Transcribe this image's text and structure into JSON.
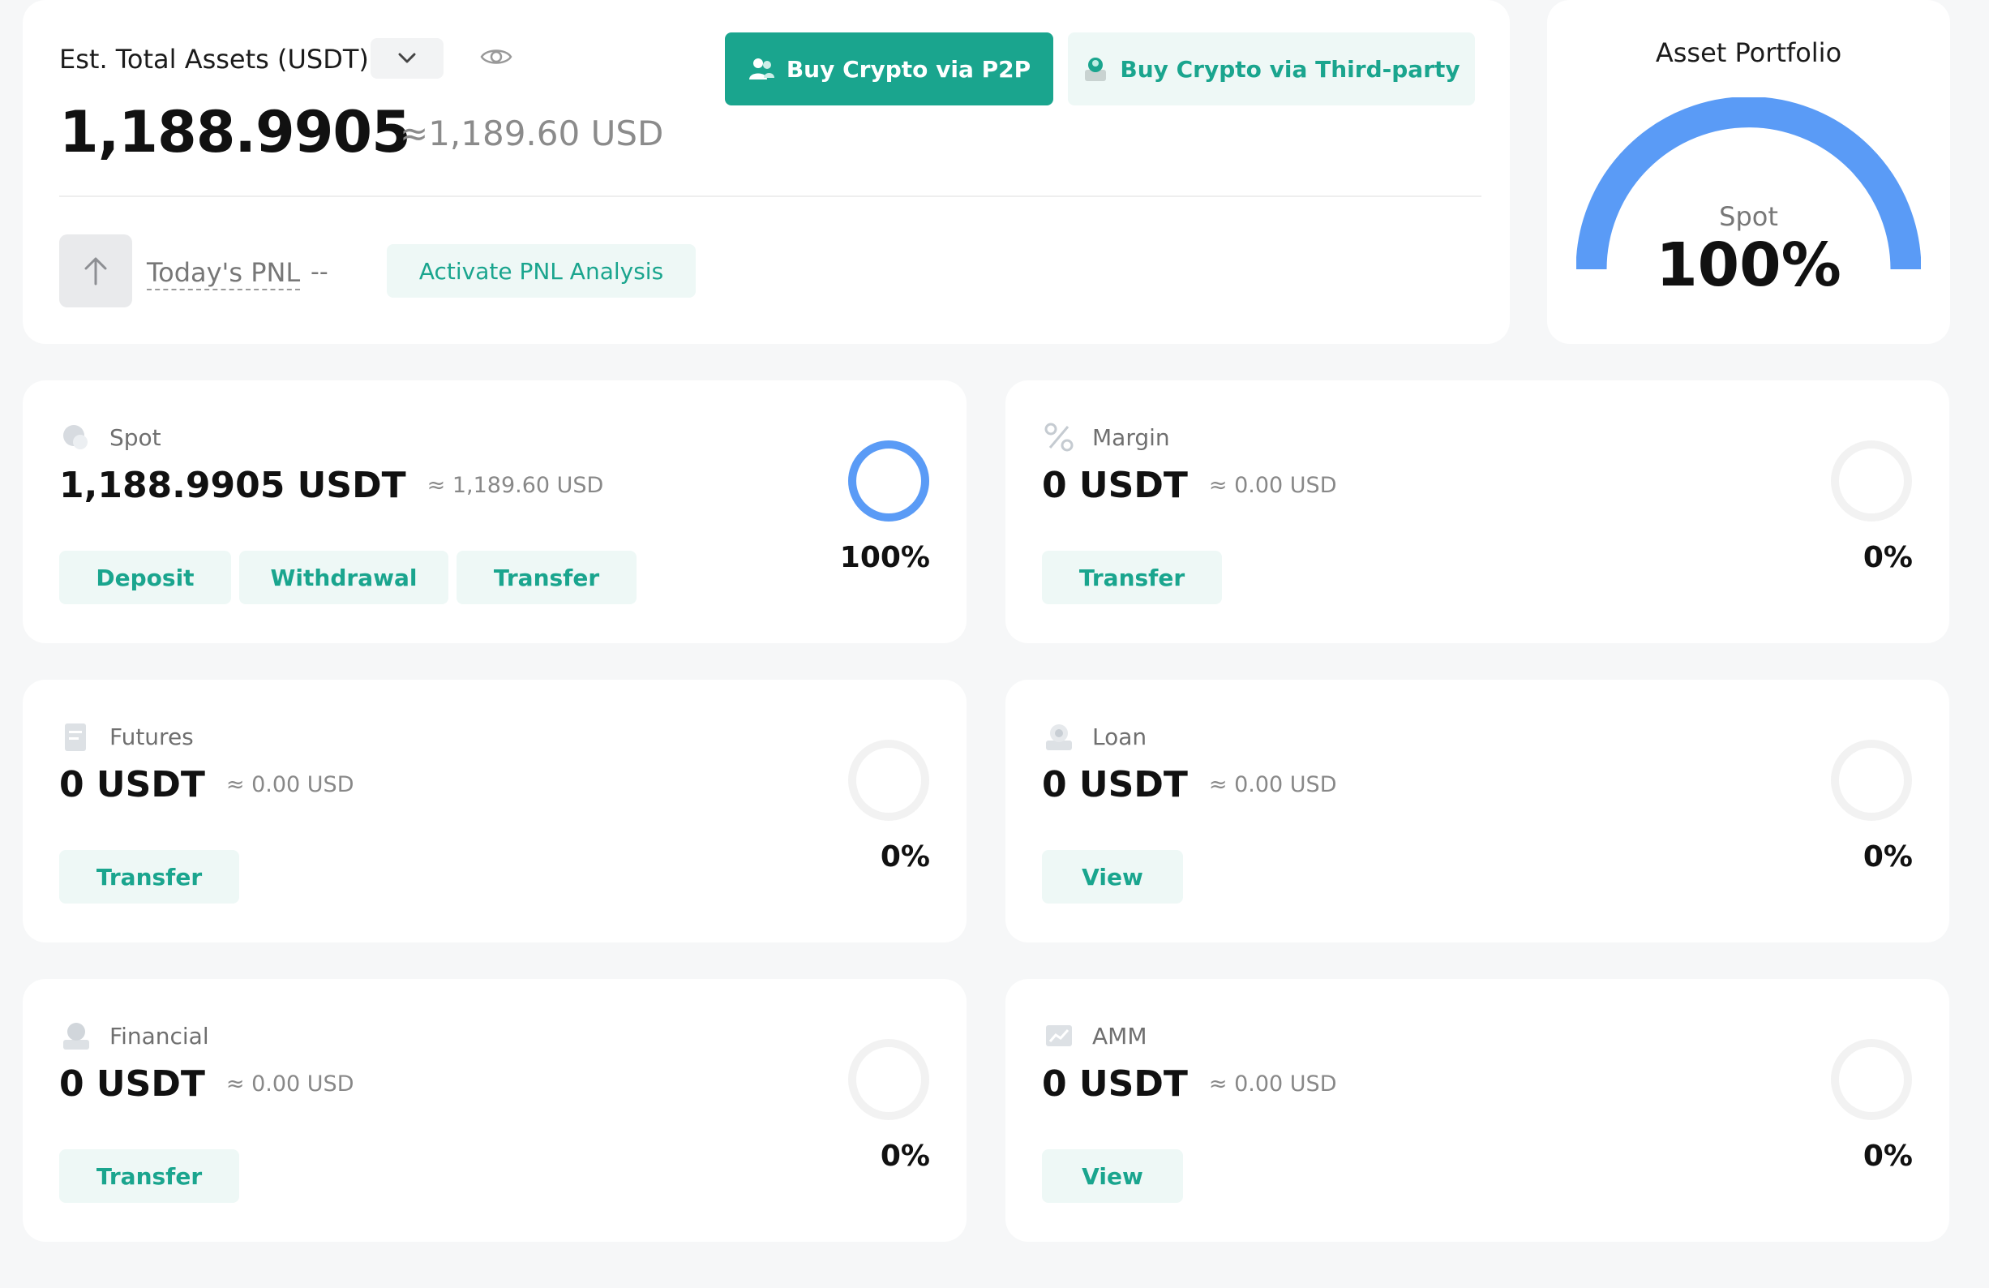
{
  "summary": {
    "est_label": "Est. Total Assets (USDT)",
    "total_value": "1,188.9905",
    "total_usd": "≈1,189.60 USD",
    "pnl_label": "Today's PNL",
    "pnl_value": "--",
    "activate_pnl_label": "Activate PNL Analysis",
    "buy_p2p_label": "Buy Crypto via P2P",
    "buy_third_label": "Buy Crypto via Third-party"
  },
  "portfolio": {
    "title": "Asset Portfolio",
    "segment_label": "Spot",
    "segment_pct": "100%",
    "spot_fraction": 1.0
  },
  "colors": {
    "accent": "#1aa58e",
    "accent_light": "#eef8f6",
    "gauge_blue": "#5a9bf6",
    "ring_empty": "#f2f2f2"
  },
  "accounts": [
    {
      "name": "Spot",
      "value": "1,188.9905 USDT",
      "approx": "≈ 1,189.60 USD",
      "pct": "100%",
      "fraction": 1.0,
      "icon": "coins-icon",
      "buttons": [
        "Deposit",
        "Withdrawal",
        "Transfer"
      ]
    },
    {
      "name": "Margin",
      "value": "0 USDT",
      "approx": "≈ 0.00 USD",
      "pct": "0%",
      "fraction": 0,
      "icon": "percent-icon",
      "buttons": [
        "Transfer"
      ]
    },
    {
      "name": "Futures",
      "value": "0 USDT",
      "approx": "≈ 0.00 USD",
      "pct": "0%",
      "fraction": 0,
      "icon": "document-icon",
      "buttons": [
        "Transfer"
      ]
    },
    {
      "name": "Loan",
      "value": "0 USDT",
      "approx": "≈ 0.00 USD",
      "pct": "0%",
      "fraction": 0,
      "icon": "loan-icon",
      "buttons": [
        "View"
      ]
    },
    {
      "name": "Financial",
      "value": "0 USDT",
      "approx": "≈ 0.00 USD",
      "pct": "0%",
      "fraction": 0,
      "icon": "financial-icon",
      "buttons": [
        "Transfer"
      ]
    },
    {
      "name": "AMM",
      "value": "0 USDT",
      "approx": "≈ 0.00 USD",
      "pct": "0%",
      "fraction": 0,
      "icon": "chart-icon",
      "buttons": [
        "View"
      ]
    }
  ]
}
